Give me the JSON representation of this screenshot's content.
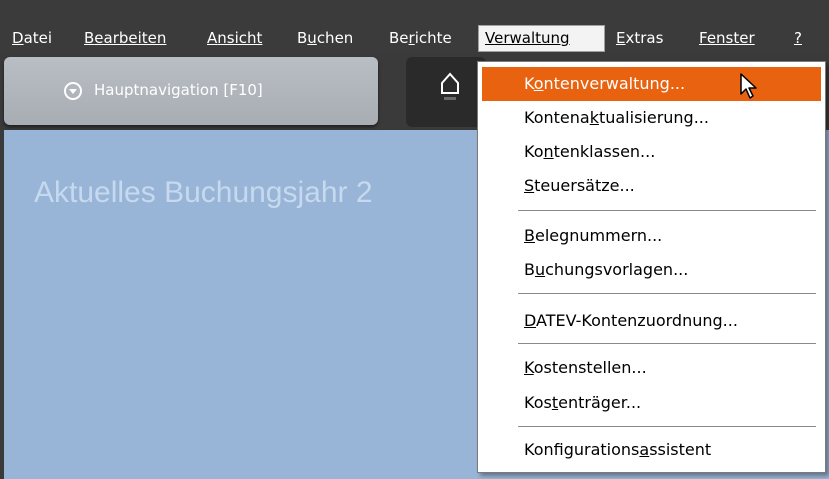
{
  "menubar": {
    "items": [
      {
        "pre": "",
        "acc": "D",
        "post": "atei"
      },
      {
        "pre": "",
        "acc": "B",
        "post": "earbeiten"
      },
      {
        "pre": "",
        "acc": "A",
        "post": "nsicht"
      },
      {
        "pre": "B",
        "acc": "u",
        "post": "chen"
      },
      {
        "pre": "Be",
        "acc": "r",
        "post": "ichte"
      },
      {
        "pre": "",
        "acc": "V",
        "post": "erwaltung"
      },
      {
        "pre": "",
        "acc": "E",
        "post": "xtras"
      },
      {
        "pre": "",
        "acc": "F",
        "post": "enster"
      },
      {
        "pre": "",
        "acc": "?",
        "post": ""
      }
    ]
  },
  "tabs": {
    "nav_label": "Hauptnavigation [F10]",
    "home_icon": "house-icon"
  },
  "content": {
    "title": "Aktuelles Buchungsjahr 2"
  },
  "dropdown": {
    "items": [
      {
        "pre": "K",
        "acc": "o",
        "post": "ntenverwaltung..."
      },
      {
        "pre": "Kontena",
        "acc": "k",
        "post": "tualisierung..."
      },
      {
        "pre": "Ko",
        "acc": "n",
        "post": "tenklassen..."
      },
      {
        "pre": "",
        "acc": "S",
        "post": "teuersätze..."
      },
      {
        "pre": "",
        "acc": "B",
        "post": "elegnummern..."
      },
      {
        "pre": "B",
        "acc": "u",
        "post": "chungsvorlagen..."
      },
      {
        "pre": "",
        "acc": "D",
        "post": "ATEV-Kontenzuordnung..."
      },
      {
        "pre": "",
        "acc": "K",
        "post": "ostenstellen..."
      },
      {
        "pre": "Kos",
        "acc": "t",
        "post": "enträger..."
      },
      {
        "pre": "Konfigurations",
        "acc": "a",
        "post": "ssistent"
      }
    ]
  },
  "colors": {
    "highlight": "#e8620f",
    "content_bg": "#98b5d7",
    "menubar_bg": "#3b3b3b"
  }
}
